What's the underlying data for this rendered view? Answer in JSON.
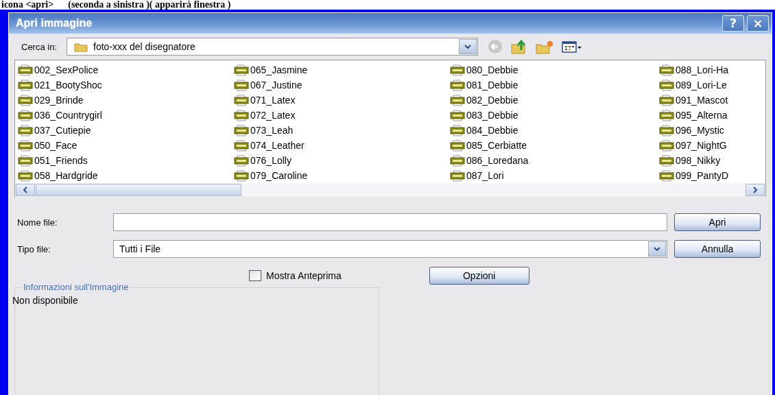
{
  "caption": "icona <apri>      (seconda a sinistra )( apparirà finestra )",
  "window": {
    "title": "Apri immagine",
    "help": "?",
    "close": "×"
  },
  "look_in": {
    "label": "Cerca in:",
    "value": "foto-xxx del disegnatore"
  },
  "files": [
    {
      "name": "002_SexPolice"
    },
    {
      "name": "021_BootyShoc"
    },
    {
      "name": "029_Brinde"
    },
    {
      "name": "036_Countrygirl"
    },
    {
      "name": "037_Cutiepie"
    },
    {
      "name": "050_Face"
    },
    {
      "name": "051_Friends"
    },
    {
      "name": "058_Hardgride"
    },
    {
      "name": "065_Jasmine"
    },
    {
      "name": "067_Justine"
    },
    {
      "name": "071_Latex"
    },
    {
      "name": "072_Latex"
    },
    {
      "name": "073_Leah"
    },
    {
      "name": "074_Leather"
    },
    {
      "name": "076_Lolly"
    },
    {
      "name": "079_Caroline"
    },
    {
      "name": "080_Debbie"
    },
    {
      "name": "081_Debbie"
    },
    {
      "name": "082_Debbie"
    },
    {
      "name": "083_Debbie"
    },
    {
      "name": "084_Debbie"
    },
    {
      "name": "085_Cerbiatte"
    },
    {
      "name": "086_Loredana"
    },
    {
      "name": "087_Lori"
    },
    {
      "name": "088_Lori-Ha"
    },
    {
      "name": "089_Lori-Le"
    },
    {
      "name": "091_Mascot"
    },
    {
      "name": "095_Alterna"
    },
    {
      "name": "096_Mystic"
    },
    {
      "name": "097_NightG"
    },
    {
      "name": "098_Nikky"
    },
    {
      "name": "099_PantyD"
    }
  ],
  "file_name": {
    "label": "Nome file:"
  },
  "file_type": {
    "label": "Tipo file:",
    "value": "Tutti i File"
  },
  "buttons": [
    {
      "label": "Apri"
    },
    {
      "label": "Annulla"
    }
  ],
  "preview": {
    "label": "Mostra Anteprima",
    "checked": false
  },
  "options_button": {
    "label": "Opzioni"
  },
  "info": {
    "title": "Informazioni sull'Immagine",
    "text": "Non disponibile"
  }
}
